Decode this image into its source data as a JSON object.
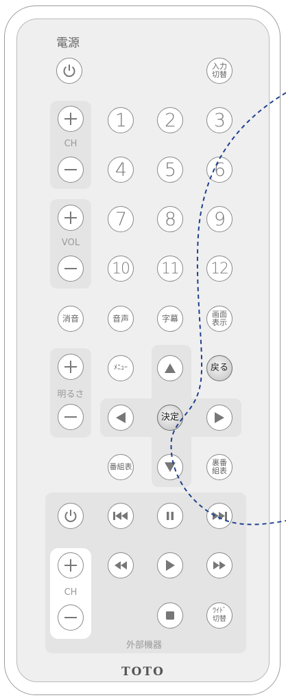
{
  "power_label": "電源",
  "input_switch": [
    "入力",
    "切替"
  ],
  "ch_label": "CH",
  "vol_label": "VOL",
  "brightness_label": "明るさ",
  "numbers": [
    "1",
    "2",
    "3",
    "4",
    "5",
    "6",
    "7",
    "8",
    "9",
    "10",
    "11",
    "12"
  ],
  "mute": "消音",
  "audio": "音声",
  "subtitle": "字幕",
  "screen_display": [
    "画面",
    "表示"
  ],
  "menu": "ﾒﾆｭｰ",
  "back": "戻る",
  "enter": "決定",
  "program_guide": "番組表",
  "rear_guide": [
    "裏番",
    "組表"
  ],
  "external_label": "外部機器",
  "ext_ch_label": "CH",
  "wide_switch": [
    "ﾜｲﾄﾞ",
    "切替"
  ],
  "brand": "TOTO",
  "icons": [
    "power-icon",
    "plus-icon",
    "minus-icon",
    "arrow-up-icon",
    "arrow-down-icon",
    "arrow-left-icon",
    "arrow-right-icon",
    "skip-back-icon",
    "pause-icon",
    "skip-forward-icon",
    "rewind-icon",
    "play-icon",
    "fast-forward-icon",
    "stop-icon"
  ],
  "colors": {
    "outline": "#8a8a8a",
    "callout": "#1f3f8f",
    "panel": "#e4e4e4",
    "body": "#efefef"
  }
}
